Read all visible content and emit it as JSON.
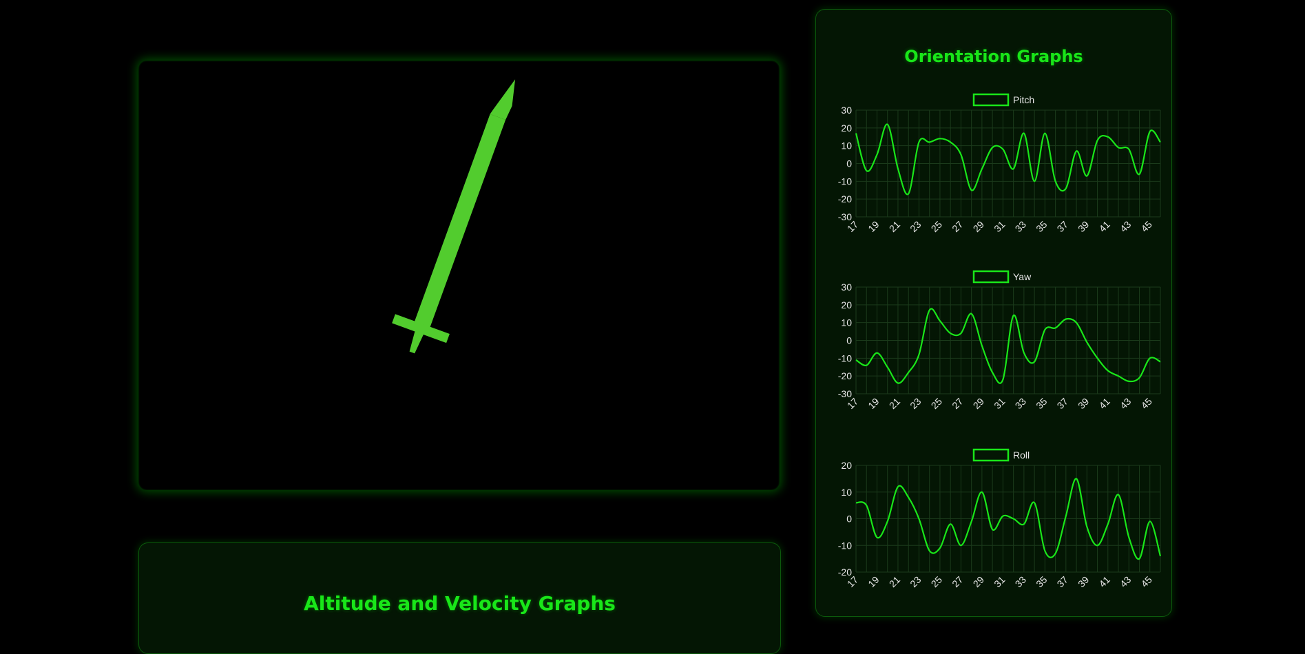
{
  "viewport": {
    "model": "rocket",
    "model_color": "#52cc2e",
    "pitch_deg": 20
  },
  "orientation": {
    "title": "Orientation Graphs"
  },
  "altitude": {
    "title": "Altitude and Velocity Graphs"
  },
  "colors": {
    "accent": "#19e619",
    "grid": "#1b3a1b",
    "panel_bg": "#041604",
    "tick": "#e6e6e6"
  },
  "chart_data": [
    {
      "type": "line",
      "name": "pitch-chart",
      "series": [
        {
          "name": "Pitch",
          "x": [
            17,
            18,
            19,
            20,
            21,
            22,
            23,
            24,
            25,
            26,
            27,
            28,
            29,
            30,
            31,
            32,
            33,
            34,
            35,
            36,
            37,
            38,
            39,
            40,
            41,
            42,
            43,
            44,
            45,
            46
          ],
          "values": [
            17,
            -4,
            5,
            22,
            -3,
            -17,
            12,
            12,
            14,
            12,
            5,
            -15,
            -3,
            9,
            8,
            -3,
            17,
            -10,
            17,
            -10,
            -14,
            7,
            -7,
            13,
            15,
            9,
            8,
            -6,
            18,
            12
          ]
        }
      ],
      "x_ticks": [
        "17",
        "19",
        "21",
        "23",
        "25",
        "27",
        "29",
        "31",
        "33",
        "35",
        "37",
        "39",
        "41",
        "43",
        "45"
      ],
      "y_ticks": [
        "30",
        "20",
        "10",
        "0",
        "-10",
        "-20",
        "-30"
      ],
      "ylim": [
        -30,
        30
      ],
      "legend": "top"
    },
    {
      "type": "line",
      "name": "yaw-chart",
      "series": [
        {
          "name": "Yaw",
          "x": [
            17,
            18,
            19,
            20,
            21,
            22,
            23,
            24,
            25,
            26,
            27,
            28,
            29,
            30,
            31,
            32,
            33,
            34,
            35,
            36,
            37,
            38,
            39,
            40,
            41,
            42,
            43,
            44,
            45,
            46
          ],
          "values": [
            -11,
            -14,
            -7,
            -15,
            -24,
            -18,
            -8,
            17,
            11,
            4,
            4,
            15,
            -3,
            -18,
            -22,
            14,
            -7,
            -12,
            6,
            7,
            12,
            10,
            -1,
            -10,
            -17,
            -20,
            -23,
            -21,
            -10,
            -12
          ]
        }
      ],
      "x_ticks": [
        "17",
        "19",
        "21",
        "23",
        "25",
        "27",
        "29",
        "31",
        "33",
        "35",
        "37",
        "39",
        "41",
        "43",
        "45"
      ],
      "y_ticks": [
        "30",
        "20",
        "10",
        "0",
        "-10",
        "-20",
        "-30"
      ],
      "ylim": [
        -30,
        30
      ],
      "legend": "top"
    },
    {
      "type": "line",
      "name": "roll-chart",
      "series": [
        {
          "name": "Roll",
          "x": [
            17,
            18,
            19,
            20,
            21,
            22,
            23,
            24,
            25,
            26,
            27,
            28,
            29,
            30,
            31,
            32,
            33,
            34,
            35,
            36,
            37,
            38,
            39,
            40,
            41,
            42,
            43,
            44,
            45,
            46
          ],
          "values": [
            6,
            5,
            -7,
            -1,
            12,
            8,
            0,
            -12,
            -11,
            -2,
            -10,
            -1,
            10,
            -4,
            1,
            0,
            -2,
            6,
            -12,
            -13,
            1,
            15,
            -3,
            -10,
            -2,
            9,
            -7,
            -15,
            -1,
            -14
          ]
        }
      ],
      "x_ticks": [
        "17",
        "19",
        "21",
        "23",
        "25",
        "27",
        "29",
        "31",
        "33",
        "35",
        "37",
        "39",
        "41",
        "43",
        "45"
      ],
      "y_ticks": [
        "20",
        "10",
        "0",
        "-10",
        "-20"
      ],
      "ylim": [
        -20,
        20
      ],
      "legend": "top"
    }
  ]
}
